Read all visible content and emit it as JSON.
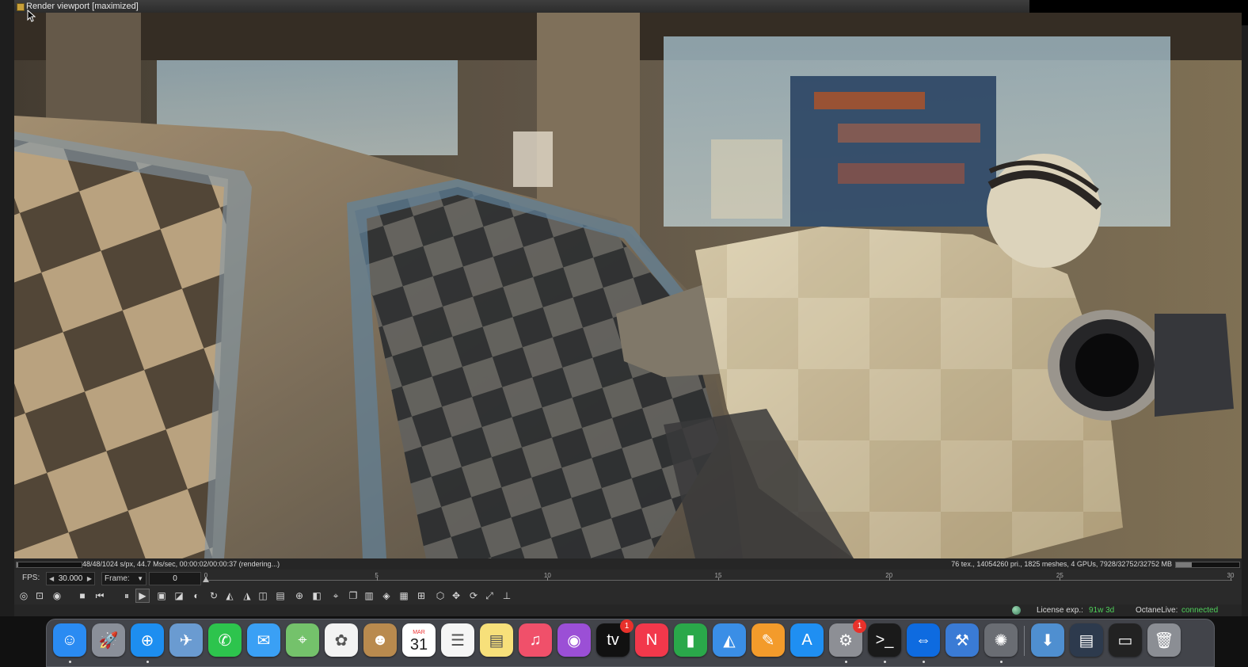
{
  "window": {
    "title": "Render viewport [maximized]"
  },
  "status": {
    "left_text": "48/48/1024 s/px, 44.7 Ms/sec, 00:00:02/00:00:37 (rendering...)",
    "right_text": "76 tex., 14054260 pri., 1825 meshes, 4 GPUs, 7928/32752/32752 MB",
    "left_progress": 0.02,
    "right_progress": 0.25
  },
  "timeline": {
    "fps_label": "FPS:",
    "fps_value": "30.000",
    "frame_label": "Frame:",
    "frame_value": "0",
    "ticks": [
      "0",
      "5",
      "10",
      "15",
      "20",
      "25",
      "30"
    ],
    "ruler_max": 30,
    "current_frame": 0
  },
  "toolbar": {
    "buttons": [
      {
        "name": "reset-camera-icon",
        "glyph": "◎"
      },
      {
        "name": "region-render-icon",
        "glyph": "⊡"
      },
      {
        "name": "color-picker-icon",
        "glyph": "◉"
      },
      {
        "name": "stop-icon",
        "glyph": "■"
      },
      {
        "name": "restart-icon",
        "glyph": "⏮"
      },
      {
        "name": "pause-icon",
        "glyph": "⏸"
      },
      {
        "name": "play-icon",
        "glyph": "▶"
      },
      {
        "name": "realtime-icon",
        "glyph": "▣"
      },
      {
        "name": "af-region-icon",
        "glyph": "◪"
      },
      {
        "name": "color-correction-icon",
        "glyph": "◐"
      },
      {
        "name": "lock-icon",
        "glyph": "↻"
      },
      {
        "name": "pick-focus-icon",
        "glyph": "◭"
      },
      {
        "name": "pick-material-icon",
        "glyph": "◮"
      },
      {
        "name": "pick-object-icon",
        "glyph": "◫"
      },
      {
        "name": "film-region-icon",
        "glyph": "▤"
      },
      {
        "name": "zoom-icon",
        "glyph": "⊕"
      },
      {
        "name": "fit-view-icon",
        "glyph": "◧"
      },
      {
        "name": "snapshot-icon",
        "glyph": "⌖"
      },
      {
        "name": "copy-icon",
        "glyph": "❐"
      },
      {
        "name": "save-image-icon",
        "glyph": "▥"
      },
      {
        "name": "clay-mode-icon",
        "glyph": "◈"
      },
      {
        "name": "subsample-icon",
        "glyph": "▦"
      },
      {
        "name": "decal-icon",
        "glyph": "⊞"
      },
      {
        "name": "cube-icon",
        "glyph": "⬡"
      },
      {
        "name": "move-icon",
        "glyph": "✥"
      },
      {
        "name": "rotate-icon",
        "glyph": "⟳"
      },
      {
        "name": "scale-icon",
        "glyph": "⤢"
      },
      {
        "name": "axis-gizmo-icon",
        "glyph": "⊥"
      }
    ]
  },
  "bottom_status": {
    "license_label": "License exp.:",
    "license_value": "91w 3d",
    "octanelive_label": "OctaneLive:",
    "octanelive_value": "connected"
  },
  "dock": {
    "apps": [
      {
        "name": "finder-icon",
        "glyph": "☺",
        "color": "#2a8bf2",
        "running": true
      },
      {
        "name": "launchpad-icon",
        "glyph": "🚀",
        "color": "#8a8f99",
        "running": false
      },
      {
        "name": "safari-icon",
        "glyph": "⊕",
        "color": "#1d8ef0",
        "running": true
      },
      {
        "name": "preview-icon",
        "glyph": "✈",
        "color": "#6a9bd1",
        "running": false
      },
      {
        "name": "facetime-icon",
        "glyph": "✆",
        "color": "#2dc44d",
        "running": false
      },
      {
        "name": "messages-icon",
        "glyph": "✉",
        "color": "#3aa0f5",
        "running": false
      },
      {
        "name": "maps-icon",
        "glyph": "⌖",
        "color": "#74c26b",
        "running": false
      },
      {
        "name": "photos-icon",
        "glyph": "✿",
        "color": "#f3f3f3",
        "running": false
      },
      {
        "name": "contacts-icon",
        "glyph": "☻",
        "color": "#b98a4e",
        "running": false
      },
      {
        "name": "calendar-icon",
        "glyph": "",
        "color": "#ffffff",
        "running": false,
        "month": "MAR",
        "day": "31"
      },
      {
        "name": "reminders-icon",
        "glyph": "☰",
        "color": "#f5f5f5",
        "running": false
      },
      {
        "name": "notes-icon",
        "glyph": "▤",
        "color": "#f7e07a",
        "running": false
      },
      {
        "name": "music-icon",
        "glyph": "♫",
        "color": "#f0506a",
        "running": false
      },
      {
        "name": "podcasts-icon",
        "glyph": "◉",
        "color": "#9b4fd6",
        "running": false
      },
      {
        "name": "apple-tv-icon",
        "glyph": "tv",
        "color": "#111111",
        "running": false,
        "badge": "1"
      },
      {
        "name": "news-icon",
        "glyph": "N",
        "color": "#f2384b",
        "running": false
      },
      {
        "name": "numbers-icon",
        "glyph": "▮",
        "color": "#2aa84a",
        "running": false
      },
      {
        "name": "keynote-icon",
        "glyph": "◭",
        "color": "#3a8ee6",
        "running": false
      },
      {
        "name": "pages-icon",
        "glyph": "✎",
        "color": "#f39b2b",
        "running": false
      },
      {
        "name": "app-store-icon",
        "glyph": "A",
        "color": "#1f8ff2",
        "running": false
      },
      {
        "name": "system-preferences-icon",
        "glyph": "⚙",
        "color": "#8d8f95",
        "running": true,
        "badge": "1"
      },
      {
        "name": "terminal-icon",
        "glyph": ">_",
        "color": "#1a1a1a",
        "running": true
      },
      {
        "name": "teamviewer-icon",
        "glyph": "⇔",
        "color": "#0e6be0",
        "running": true
      },
      {
        "name": "xcode-icon",
        "glyph": "⚒",
        "color": "#3a7bd5",
        "running": false
      },
      {
        "name": "octane-icon",
        "glyph": "✺",
        "color": "#6a6d73",
        "running": true
      }
    ],
    "stacks": [
      {
        "name": "downloads-folder-icon",
        "glyph": "⬇",
        "color": "#4f8fd0"
      },
      {
        "name": "recent-window-icon",
        "glyph": "▤",
        "color": "#2d3a4d"
      },
      {
        "name": "activity-window-icon",
        "glyph": "▭",
        "color": "#222222"
      },
      {
        "name": "trash-icon",
        "glyph": "🗑",
        "color": "#8b8e94"
      }
    ]
  }
}
